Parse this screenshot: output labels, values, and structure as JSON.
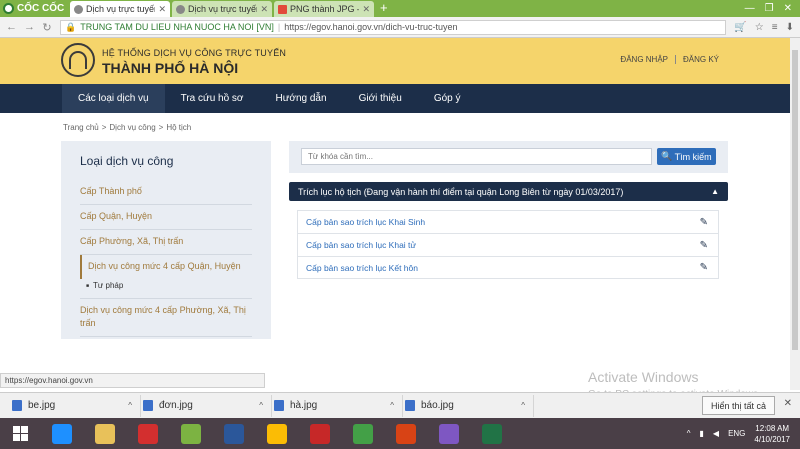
{
  "browser": {
    "brand": "CỐC CỐC",
    "tabs": [
      {
        "label": "Dịch vụ trực tuyến",
        "active": true
      },
      {
        "label": "Dịch vụ trực tuyến –C",
        "active": false
      },
      {
        "label": "PNG thành JPG – Chu",
        "active": false
      }
    ],
    "new_tab": "+",
    "address": {
      "secure_label": "TRUNG TAM DU LIEU NHA NUOC HA NOI [VN]",
      "url": "https://egov.hanoi.gov.vn/dich-vu-truc-tuyen"
    },
    "status_url": "https://egov.hanoi.gov.vn"
  },
  "site": {
    "subtitle": "HỆ THỐNG DỊCH VỤ CÔNG TRỰC TUYẾN",
    "title": "THÀNH PHỐ HÀ NỘI",
    "login": "ĐĂNG NHẬP",
    "register": "ĐĂNG KÝ",
    "nav": [
      "Các loại dịch vụ",
      "Tra cứu hồ sơ",
      "Hướng dẫn",
      "Giới thiệu",
      "Góp ý"
    ]
  },
  "breadcrumb": [
    "Trang chủ",
    ">",
    "Dịch vụ công",
    ">",
    "Hộ tịch"
  ],
  "sidebar": {
    "title": "Loại dịch vụ công",
    "items": [
      "Cấp Thành phố",
      "Cấp Quận, Huyện",
      "Cấp Phường, Xã, Thị trấn",
      "Dịch vụ công mức 4 cấp Quận, Huyện",
      "Dịch vụ công mức 4 cấp Phường, Xã, Thị trấn"
    ],
    "sub_item": "Tư pháp"
  },
  "search": {
    "placeholder": "Từ khóa cần tìm...",
    "button": "Tìm kiếm"
  },
  "panel": {
    "title": "Trích lục hộ tịch (Đang vận hành thí điểm tại quận Long Biên từ ngày 01/03/2017)",
    "records": [
      "Cấp bản sao trích lục Khai Sinh",
      "Cấp bản sao trích lục Khai tử",
      "Cấp bản sao trích lục Kết hôn"
    ]
  },
  "activation": {
    "title": "Activate Windows",
    "subtitle": "Go to PC settings to activate Windows."
  },
  "downloads": {
    "files": [
      "be.jpg",
      "đơn.jpg",
      "hà.jpg",
      "báo.jpg"
    ],
    "show_all": "Hiển thị tất cả"
  },
  "taskbar": {
    "lang": "ENG",
    "time": "12:08 AM",
    "date": "4/10/2017",
    "app_colors": [
      "#1e90ff",
      "#e8c15a",
      "#d32f2f",
      "#7cb342",
      "#2b579a",
      "#fbbc05",
      "#c62828",
      "#43a047",
      "#d84315",
      "#7e57c2",
      "#217346"
    ]
  }
}
